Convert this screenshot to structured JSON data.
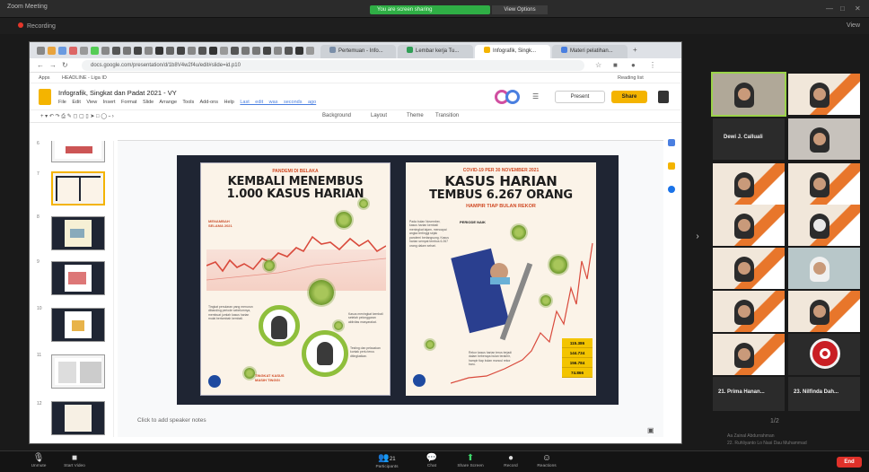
{
  "zoom": {
    "window_title": "Zoom Meeting",
    "recording_label": "Recording",
    "view_label": "View",
    "share_status": "You are screen sharing",
    "stop_share": "Stop Share",
    "view_options": "View Options",
    "bottom_controls": [
      {
        "icon": "mic-icon",
        "glyph": "🎙",
        "label": "Unmute"
      },
      {
        "icon": "video-icon",
        "glyph": "■",
        "label": "Start Video"
      },
      {
        "icon": "participants-icon",
        "glyph": "👥",
        "label": "Participants"
      },
      {
        "icon": "chat-icon",
        "glyph": "💬",
        "label": "Chat"
      },
      {
        "icon": "share-screen-icon",
        "glyph": "⬆",
        "label": "Share Screen"
      },
      {
        "icon": "record-icon",
        "glyph": "●",
        "label": "Record"
      },
      {
        "icon": "reactions-icon",
        "glyph": "☺",
        "label": "Reactions"
      }
    ],
    "participants_count": "21",
    "end_label": "End"
  },
  "browser": {
    "tabs": [
      "Pertemuan - Info...",
      "Lembar kerja Tu...",
      "Infografik, Singk...",
      "Materi pelatihan..."
    ],
    "url": "docs.google.com/presentation/d/1b8V4w2f4u/edit#slide=id.p10",
    "bookmarks": [
      "Apps",
      "HEADLINE - Liga ID",
      "Reading list"
    ]
  },
  "slides_app": {
    "doc_title": "Infografik, Singkat dan Padat 2021 - VY",
    "menu": "File Edit View Insert Format Slide Arrange Tools Add-ons Help",
    "last_edit": "Last edit was seconds ago",
    "present_label": "Present",
    "share_label": "Share",
    "toolbar": [
      "Background",
      "Layout",
      "Theme",
      "Transition"
    ],
    "notes_placeholder": "Click to add speaker notes",
    "slide_numbers": [
      "6",
      "7",
      "8",
      "9",
      "10",
      "11",
      "12"
    ]
  },
  "poster_left": {
    "kicker": "PANDEMI DI BELAKA",
    "headline_1": "KEMBALI MENEMBUS",
    "headline_2": "1.000 KASUS HARIAN",
    "label_a": "MENAMBAH SELAMA 2021",
    "label_b": "TINGKAT KASUS MASIH TINGGI"
  },
  "poster_right": {
    "kicker": "COVID-19 PER 30 NOVEMBER 2021",
    "headline_1": "KASUS HARIAN",
    "headline_2": "TEMBUS 6.267 ORANG",
    "sub": "HAMPIR TIAP BULAN REKOR",
    "label": "PERIODE NAIK",
    "stats": [
      "115.386",
      "144.734",
      "156.784",
      "74.866"
    ]
  },
  "gallery": {
    "tile_name_1": "Dewi J. Calluali",
    "tile_name_2": "21. Prima Hanan...",
    "tile_name_3": "23. Nilfinda Dah...",
    "page_indicator": "1/2",
    "footer_1": "Aa Zainal Abdurrahman",
    "footer_2": "22. Ruhliyanto Lo Nasi Dau Muhammad"
  }
}
